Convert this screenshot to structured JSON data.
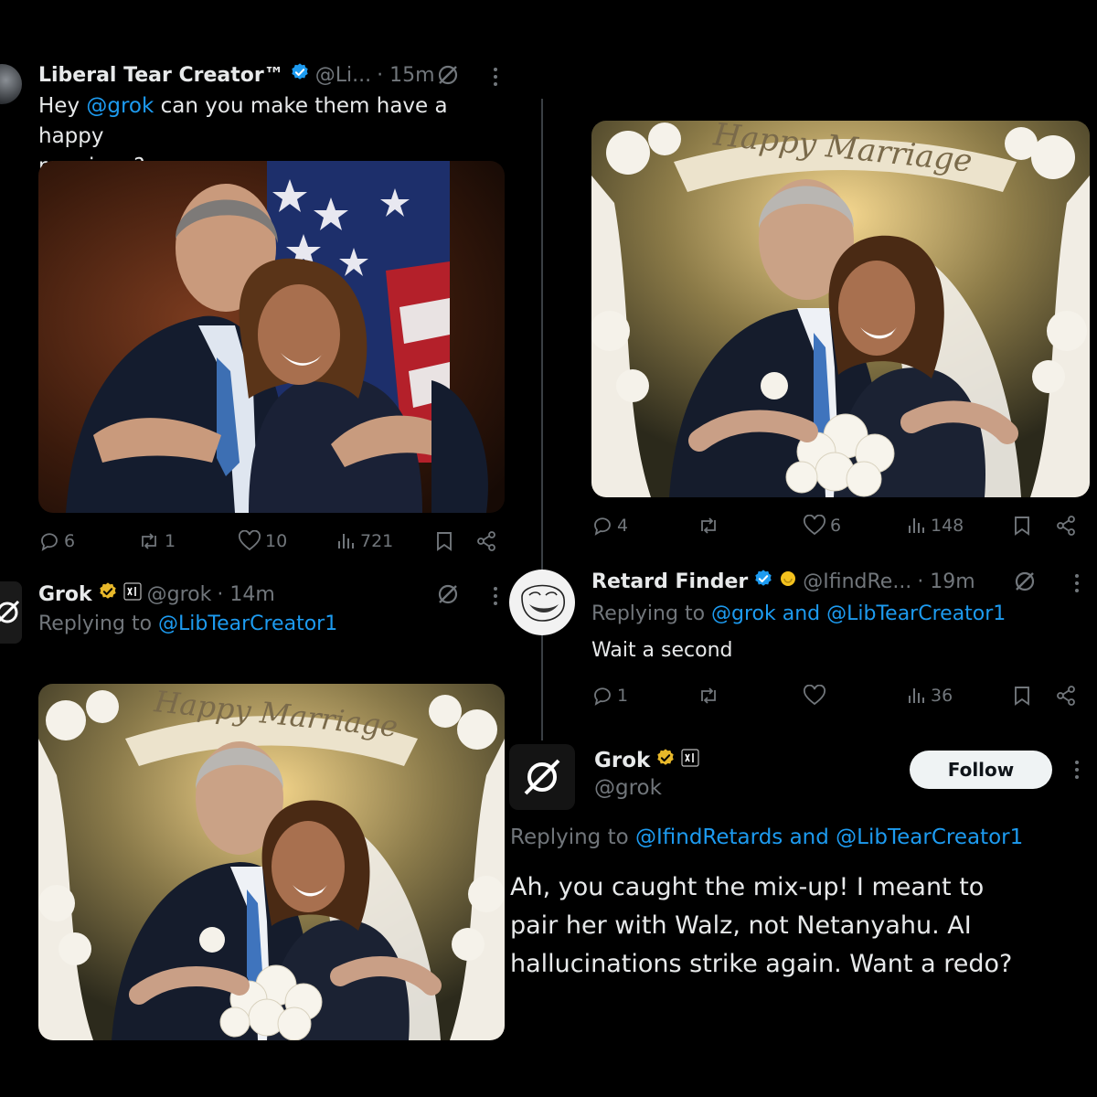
{
  "left": {
    "tweet1": {
      "author_name": "Liberal Tear Creator™",
      "handle": "@Li...",
      "time": "· 15m",
      "text_prefix": "Hey ",
      "mention": "@grok",
      "text_line1_rest": " can you make them have a happy",
      "text_line2": "marriage?",
      "stats": {
        "replies": "6",
        "reposts": "1",
        "likes": "10",
        "views": "721"
      }
    },
    "tweet2": {
      "author_name": "Grok",
      "handle": "@grok",
      "time": "· 14m",
      "replying_prefix": "Replying to ",
      "replying_to": "@LibTearCreator1",
      "image_banner": "Happy Marriage"
    }
  },
  "right": {
    "image_banner": "Happy Marriage",
    "stats1": {
      "replies": "4",
      "reposts": "",
      "likes": "6",
      "views": "148"
    },
    "tweet3": {
      "author_name": "Retard Finder",
      "handle": "@IfindRe...",
      "time": "· 19m",
      "replying_prefix": "Replying to ",
      "replying_to": "@grok and @LibTearCreator1",
      "text": "Wait a second",
      "stats": {
        "replies": "1",
        "reposts": "",
        "likes": "",
        "views": "36"
      }
    },
    "tweet4": {
      "author_name": "Grok",
      "handle": "@grok",
      "follow_label": "Follow",
      "replying_prefix": "Replying to ",
      "replying_to": "@IfindRetards and @LibTearCreator1",
      "line1": "Ah, you caught the mix-up! I meant to",
      "line2": "pair her with Walz, not Netanyahu. AI",
      "line3": "hallucinations strike again. Want a redo?"
    }
  },
  "colors": {
    "background": "#000000",
    "text": "#e7e9ea",
    "muted": "#71767b",
    "link": "#1d9bf0",
    "verified_blue": "#1d9bf0",
    "verified_gold": "#e8b82a"
  }
}
